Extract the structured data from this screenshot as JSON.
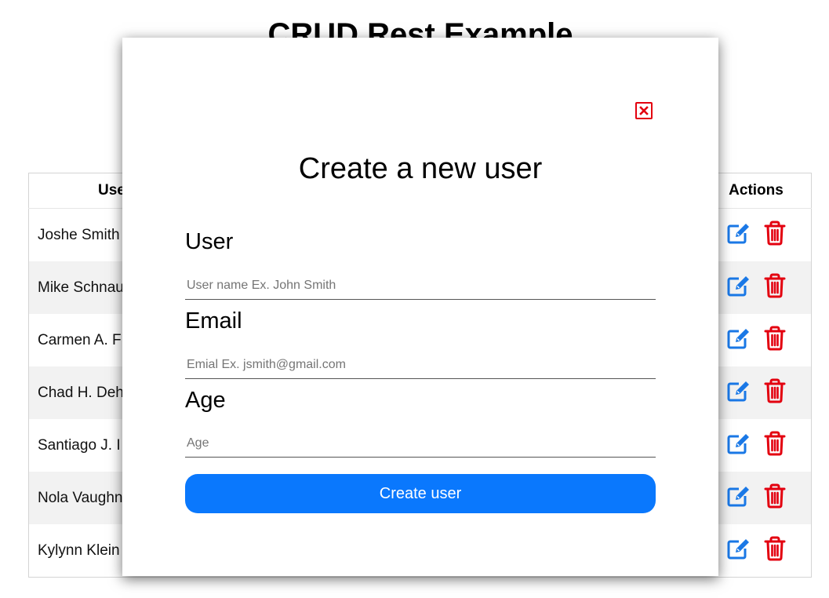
{
  "page": {
    "title": "CRUD Rest Example"
  },
  "table": {
    "headers": {
      "user": "User",
      "actions": "Actions"
    },
    "rows": [
      {
        "name": "Joshe Smith"
      },
      {
        "name": "Mike Schnau"
      },
      {
        "name": "Carmen A. F"
      },
      {
        "name": "Chad H. Deh"
      },
      {
        "name": "Santiago J. I"
      },
      {
        "name": "Nola Vaughn"
      },
      {
        "name": "Kylynn Klein"
      }
    ],
    "action_icons": {
      "edit": "edit-icon",
      "delete": "trash-icon"
    }
  },
  "modal": {
    "title": "Create a new user",
    "close_icon": "close-icon",
    "fields": {
      "user": {
        "label": "User",
        "placeholder": "User name Ex. John Smith",
        "value": ""
      },
      "email": {
        "label": "Email",
        "placeholder": "Emial Ex. jsmith@gmail.com",
        "value": ""
      },
      "age": {
        "label": "Age",
        "placeholder": "Age",
        "value": ""
      }
    },
    "submit_label": "Create user"
  },
  "colors": {
    "edit_icon": "#1a78e6",
    "delete_icon": "#e3000f",
    "primary_button": "#0a78fd",
    "close_border": "#e3000f",
    "row_stripe": "#f2f2f2"
  }
}
